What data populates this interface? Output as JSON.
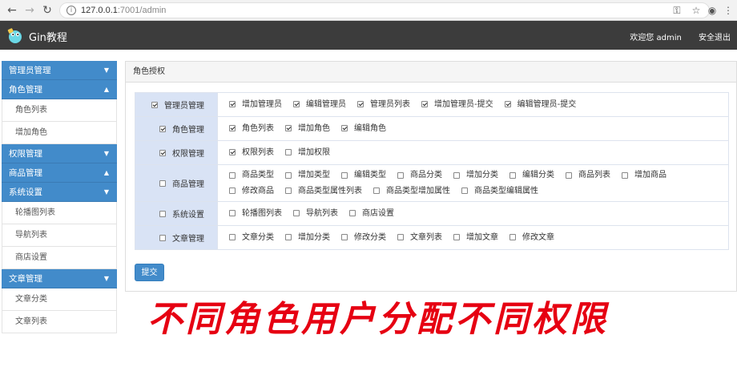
{
  "browser": {
    "url_host": "127.0.0.1",
    "url_rest": ":7001/admin",
    "icons": [
      "back-icon",
      "forward-icon",
      "reload-icon",
      "info-icon",
      "key-icon",
      "star-icon",
      "account-icon",
      "menu-icon"
    ]
  },
  "header": {
    "brand": "Gin教程",
    "welcome": "欢迎您 admin",
    "logout": "安全退出"
  },
  "sidebar": {
    "groups": [
      {
        "label": "管理员管理",
        "expanded": false,
        "items": []
      },
      {
        "label": "角色管理",
        "expanded": true,
        "items": [
          "角色列表",
          "增加角色"
        ]
      },
      {
        "label": "权限管理",
        "expanded": false,
        "items": []
      },
      {
        "label": "商品管理",
        "expanded": true,
        "items": []
      },
      {
        "label": "系统设置",
        "expanded": false,
        "items": [
          "轮播图列表",
          "导航列表",
          "商店设置"
        ]
      },
      {
        "label": "文章管理",
        "expanded": false,
        "items": [
          "文章分类",
          "文章列表"
        ]
      }
    ]
  },
  "panel": {
    "heading": "角色授权",
    "rows": [
      {
        "label": "管理员管理",
        "checked": true,
        "options": [
          {
            "label": "增加管理员",
            "checked": true
          },
          {
            "label": "编辑管理员",
            "checked": true
          },
          {
            "label": "管理员列表",
            "checked": true
          },
          {
            "label": "增加管理员-提交",
            "checked": true
          },
          {
            "label": "编辑管理员-提交",
            "checked": true
          }
        ]
      },
      {
        "label": "角色管理",
        "checked": true,
        "options": [
          {
            "label": "角色列表",
            "checked": true
          },
          {
            "label": "增加角色",
            "checked": true
          },
          {
            "label": "编辑角色",
            "checked": true
          }
        ]
      },
      {
        "label": "权限管理",
        "checked": true,
        "options": [
          {
            "label": "权限列表",
            "checked": true
          },
          {
            "label": "增加权限",
            "checked": false
          }
        ]
      },
      {
        "label": "商品管理",
        "checked": false,
        "options": [
          {
            "label": "商品类型",
            "checked": false
          },
          {
            "label": "增加类型",
            "checked": false
          },
          {
            "label": "编辑类型",
            "checked": false
          },
          {
            "label": "商品分类",
            "checked": false
          },
          {
            "label": "增加分类",
            "checked": false
          },
          {
            "label": "编辑分类",
            "checked": false
          },
          {
            "label": "商品列表",
            "checked": false
          },
          {
            "label": "增加商品",
            "checked": false
          },
          {
            "label": "修改商品",
            "checked": false
          },
          {
            "label": "商品类型属性列表",
            "checked": false
          },
          {
            "label": "商品类型增加属性",
            "checked": false
          },
          {
            "label": "商品类型编辑属性",
            "checked": false
          }
        ]
      },
      {
        "label": "系统设置",
        "checked": false,
        "options": [
          {
            "label": "轮播图列表",
            "checked": false
          },
          {
            "label": "导航列表",
            "checked": false
          },
          {
            "label": "商店设置",
            "checked": false
          }
        ]
      },
      {
        "label": "文章管理",
        "checked": false,
        "options": [
          {
            "label": "文章分类",
            "checked": false
          },
          {
            "label": "增加分类",
            "checked": false
          },
          {
            "label": "修改分类",
            "checked": false
          },
          {
            "label": "文章列表",
            "checked": false
          },
          {
            "label": "增加文章",
            "checked": false
          },
          {
            "label": "修改文章",
            "checked": false
          }
        ]
      }
    ],
    "submit_label": "提交"
  },
  "caption": "不同角色用户分配不同权限",
  "colors": {
    "accent": "#428bca",
    "header_bg": "#3c3c3c",
    "caption": "#e60012",
    "category_bg": "#d9e3f5"
  }
}
